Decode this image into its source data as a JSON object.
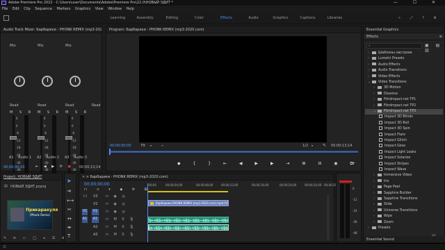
{
  "titlebar": {
    "title": "Adobe Premiere Pro 2022 - C:\\Users\\user\\Documents\\Adobe\\Premiere Pro\\22.0\\НОВЫЙ ЭДИТ *",
    "controls": "— ☐ ✕"
  },
  "menu": [
    "File",
    "Edit",
    "Clip",
    "Sequence",
    "Markers",
    "Graphics",
    "View",
    "Window",
    "Help"
  ],
  "workspaces": {
    "tabs": [
      "Learning",
      "Assembly",
      "Editing",
      "Color",
      "Effects",
      "Audio",
      "Graphics",
      "Captions",
      "Libraries"
    ],
    "active": "Effects"
  },
  "mixer": {
    "title": "Audio Track Mixer: Барбарики - PHONK REMIX (mp3-2020.com)",
    "mix_label": "Mix",
    "read_label": "Read",
    "channels": [
      {
        "name": "A1",
        "track": "Audio 1",
        "level": 0.62
      },
      {
        "name": "A2",
        "track": "Audio 2",
        "level": 0.62
      },
      {
        "name": "A3",
        "track": "Audio 3",
        "level": 0.62
      }
    ],
    "db_labels": [
      "6",
      "0",
      "-6",
      "-12",
      "-18",
      "-24",
      "-30",
      "-36",
      "-∞"
    ],
    "timecode": "00;00;00;00",
    "duration": "00;00;13;14"
  },
  "program": {
    "title": "Program: Барбарики - PHONK REMIX (mp3-2020.com)",
    "timecode": "00;00;00;00",
    "fit": "Fit",
    "ratio": "1/2",
    "duration": "00;00;13;14"
  },
  "project": {
    "title": "Project: НОВЫЙ ЭДИТ",
    "file": "НОВЫЙ ЭДИТ.prproj",
    "thumb_label": "Прикаракуля",
    "thumb_subtitle": "(Phonk Remix)"
  },
  "timeline": {
    "title": "Барбарики - PHONK REMIX (mp3-2020.com)",
    "timecode": "00;00;00;00",
    "ruler": [
      ":00;00",
      "00;00;04;00",
      "00;00;08;00",
      "00;00;12;00",
      "00;00;16;00",
      "00;00;20;00",
      "00;00;24;00",
      "00;00;28;0"
    ],
    "tracks": [
      "V3",
      "V2",
      "V1",
      "A1",
      "A2",
      "A3"
    ],
    "video_clip": "Барбарики PHONK REMIX (mp3-2020.com).mp4 [V]",
    "audio_db": [
      "0",
      "-12",
      "-24",
      "-36",
      "-48"
    ]
  },
  "effects": {
    "essential_graphics": "Essential Graphics",
    "title": "Effects",
    "tree": [
      {
        "label": "Шаблоны настроек",
        "level": 0,
        "type": "folder",
        "open": false
      },
      {
        "label": "Lumetri Presets",
        "level": 0,
        "type": "folder",
        "open": false
      },
      {
        "label": "Audio Effects",
        "level": 0,
        "type": "folder",
        "open": false
      },
      {
        "label": "Audio Transitions",
        "level": 0,
        "type": "folder",
        "open": false
      },
      {
        "label": "Video Effects",
        "level": 0,
        "type": "folder",
        "open": false
      },
      {
        "label": "Video Transitions",
        "level": 0,
        "type": "folder",
        "open": true
      },
      {
        "label": "3D Motion",
        "level": 1,
        "type": "folder",
        "open": false
      },
      {
        "label": "Dissolve",
        "level": 1,
        "type": "folder",
        "open": false
      },
      {
        "label": "FilmImpact.net TP1",
        "level": 1,
        "type": "folder",
        "open": false
      },
      {
        "label": "FilmImpact.net TP2",
        "level": 1,
        "type": "folder",
        "open": false
      },
      {
        "label": "FilmImpact.net TP3",
        "level": 1,
        "type": "folder",
        "open": true,
        "selected": true
      },
      {
        "label": "Impact 3D Blinds",
        "level": 2,
        "type": "fx"
      },
      {
        "label": "Impact 3D Roll",
        "level": 2,
        "type": "fx"
      },
      {
        "label": "Impact 3D Spin",
        "level": 2,
        "type": "fx"
      },
      {
        "label": "Impact Flare",
        "level": 2,
        "type": "fx"
      },
      {
        "label": "Impact Glitch",
        "level": 2,
        "type": "fx"
      },
      {
        "label": "Impact Glow",
        "level": 2,
        "type": "fx"
      },
      {
        "label": "Impact Light Leaks",
        "level": 2,
        "type": "fx"
      },
      {
        "label": "Impact Solarize",
        "level": 2,
        "type": "fx"
      },
      {
        "label": "Impact Stripes",
        "level": 2,
        "type": "fx"
      },
      {
        "label": "Impact Wave",
        "level": 2,
        "type": "fx"
      },
      {
        "label": "Immersive Video",
        "level": 1,
        "type": "folder",
        "open": false
      },
      {
        "label": "Iris",
        "level": 1,
        "type": "folder",
        "open": false
      },
      {
        "label": "Page Peel",
        "level": 1,
        "type": "folder",
        "open": false
      },
      {
        "label": "Sapphire Builder",
        "level": 1,
        "type": "folder",
        "open": false
      },
      {
        "label": "Sapphire Transitions",
        "level": 1,
        "type": "folder",
        "open": false
      },
      {
        "label": "Slide",
        "level": 1,
        "type": "folder",
        "open": false
      },
      {
        "label": "Universe Transitions",
        "level": 1,
        "type": "folder",
        "open": false
      },
      {
        "label": "Wipe",
        "level": 1,
        "type": "folder",
        "open": false
      },
      {
        "label": "Zoom",
        "level": 1,
        "type": "folder",
        "open": false
      },
      {
        "label": "Presets",
        "level": 0,
        "type": "folder",
        "open": false
      }
    ],
    "essential_sound": "Essential Sound"
  },
  "colors": {
    "accent": "#4aa0ff",
    "video_clip": "#6b7fb5",
    "audio_clip": "#2a8a7a",
    "playhead": "#4a8cff"
  }
}
